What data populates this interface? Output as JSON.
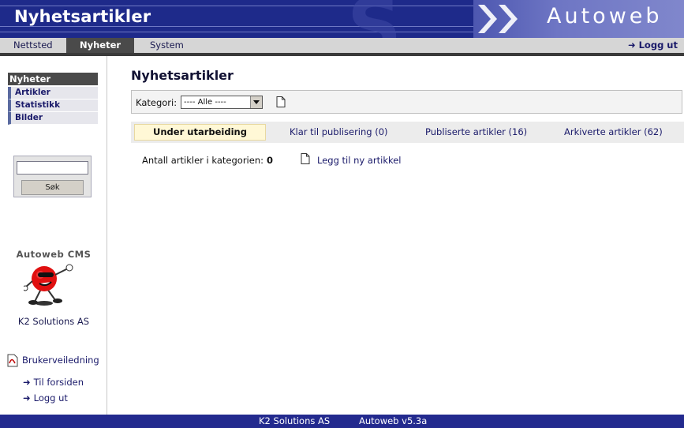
{
  "header": {
    "title": "Nyhetsartikler",
    "brand": "Autoweb"
  },
  "nav": {
    "tabs": [
      {
        "label": "Nettsted",
        "active": false
      },
      {
        "label": "Nyheter",
        "active": true
      },
      {
        "label": "System",
        "active": false
      }
    ],
    "logout": "Logg ut"
  },
  "sidebar": {
    "heading": "Nyheter",
    "items": [
      "Artikler",
      "Statistikk",
      "Bilder"
    ],
    "search": {
      "value": "",
      "button": "Søk"
    },
    "cms_title": "Autoweb CMS",
    "company": "K2 Solutions AS",
    "manual": "Brukerveiledning",
    "links": [
      "Til forsiden",
      "Logg ut"
    ]
  },
  "main": {
    "title": "Nyhetsartikler",
    "category_label": "Kategori:",
    "category_value": "---- Alle ----",
    "tabs": [
      "Under utarbeiding",
      "Klar til publisering (0)",
      "Publiserte artikler (16)",
      "Arkiverte artikler (62)"
    ],
    "count_label": "Antall artikler i kategorien:",
    "count_value": "0",
    "add_new": "Legg til ny artikkel"
  },
  "footer": {
    "company": "K2 Solutions AS",
    "version": "Autoweb v5.3a"
  },
  "colors": {
    "banner": "#1e2a8a",
    "footer": "#232a8e",
    "active_tab": "#4a4a4a",
    "highlight": "#fff8d6"
  }
}
